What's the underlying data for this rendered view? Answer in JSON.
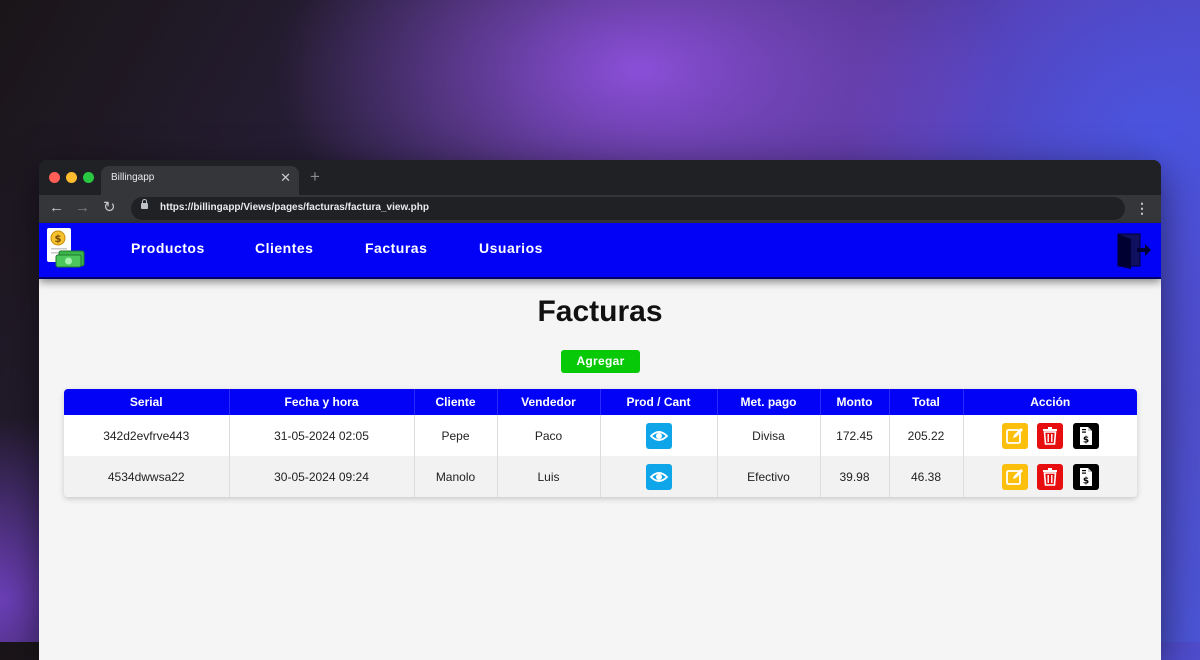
{
  "browser": {
    "tab_title": "Billingapp",
    "url": "https://billingapp/Views/pages/facturas/factura_view.php"
  },
  "nav": {
    "items": [
      "Productos",
      "Clientes",
      "Facturas",
      "Usuarios"
    ]
  },
  "page": {
    "title": "Facturas",
    "add_label": "Agregar"
  },
  "table": {
    "headers": [
      "Serial",
      "Fecha y hora",
      "Cliente",
      "Vendedor",
      "Prod / Cant",
      "Met. pago",
      "Monto",
      "Total",
      "Acción"
    ],
    "rows": [
      {
        "serial": "342d2evfrve443",
        "fecha": "31-05-2024 02:05",
        "cliente": "Pepe",
        "vendedor": "Paco",
        "metodo": "Divisa",
        "monto": "172.45",
        "total": "205.22"
      },
      {
        "serial": "4534dwwsa22",
        "fecha": "30-05-2024 09:24",
        "cliente": "Manolo",
        "vendedor": "Luis",
        "metodo": "Efectivo",
        "monto": "39.98",
        "total": "46.38"
      }
    ]
  },
  "icons": {
    "view": "eye-icon",
    "edit": "edit-icon",
    "delete": "trash-icon",
    "invoice": "invoice-icon",
    "logout": "logout-icon"
  },
  "colors": {
    "navbar": "#0202f7",
    "add_button": "#08c908",
    "view_button": "#0ea5e9",
    "edit_button": "#fbbf0c",
    "delete_button": "#e60e0e",
    "invoice_button": "#000000"
  }
}
